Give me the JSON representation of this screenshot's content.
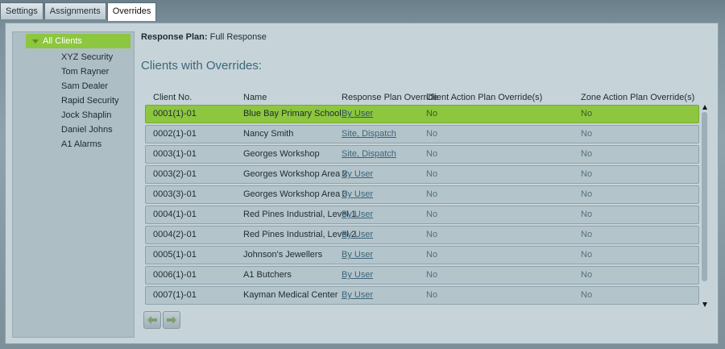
{
  "tabs": [
    "Settings",
    "Assignments",
    "Overrides"
  ],
  "sidebar": {
    "root": "All Clients",
    "items": [
      "XYZ Security",
      "Tom Rayner",
      "Sam Dealer",
      "Rapid Security",
      "Jock Shaplin",
      "Daniel Johns",
      "A1 Alarms"
    ]
  },
  "plan": {
    "label": "Response Plan:",
    "value": "Full Response"
  },
  "section_title": "Clients with Overrides:",
  "columns": [
    "Client No.",
    "Name",
    "Response Plan Override",
    "Client Action Plan Override(s)",
    "Zone Action Plan Override(s)"
  ],
  "rows": [
    [
      "0001(1)-01",
      "Blue Bay Primary School",
      "By User",
      "No",
      "No"
    ],
    [
      "0002(1)-01",
      "Nancy Smith",
      "Site, Dispatch",
      "No",
      "No"
    ],
    [
      "0003(1)-01",
      "Georges Workshop",
      "Site, Dispatch",
      "No",
      "No"
    ],
    [
      "0003(2)-01",
      "Georges Workshop Area 2",
      "By User",
      "No",
      "No"
    ],
    [
      "0003(3)-01",
      "Georges Workshop Area 3",
      "By User",
      "No",
      "No"
    ],
    [
      "0004(1)-01",
      "Red Pines Industrial, Level 1",
      "By User",
      "No",
      "No"
    ],
    [
      "0004(2)-01",
      "Red Pines Industrial, Level 2",
      "By User",
      "No",
      "No"
    ],
    [
      "0005(1)-01",
      "Johnson's Jewellers",
      "By User",
      "No",
      "No"
    ],
    [
      "0006(1)-01",
      "A1 Butchers",
      "By User",
      "No",
      "No"
    ],
    [
      "0007(1)-01",
      "Kayman Medical Center",
      "By User",
      "No",
      "No"
    ]
  ],
  "colors": {
    "selected": "#8dc63f",
    "title": "#3e6577"
  },
  "icons": {
    "prev": "arrow-left-icon",
    "next": "arrow-right-icon"
  }
}
